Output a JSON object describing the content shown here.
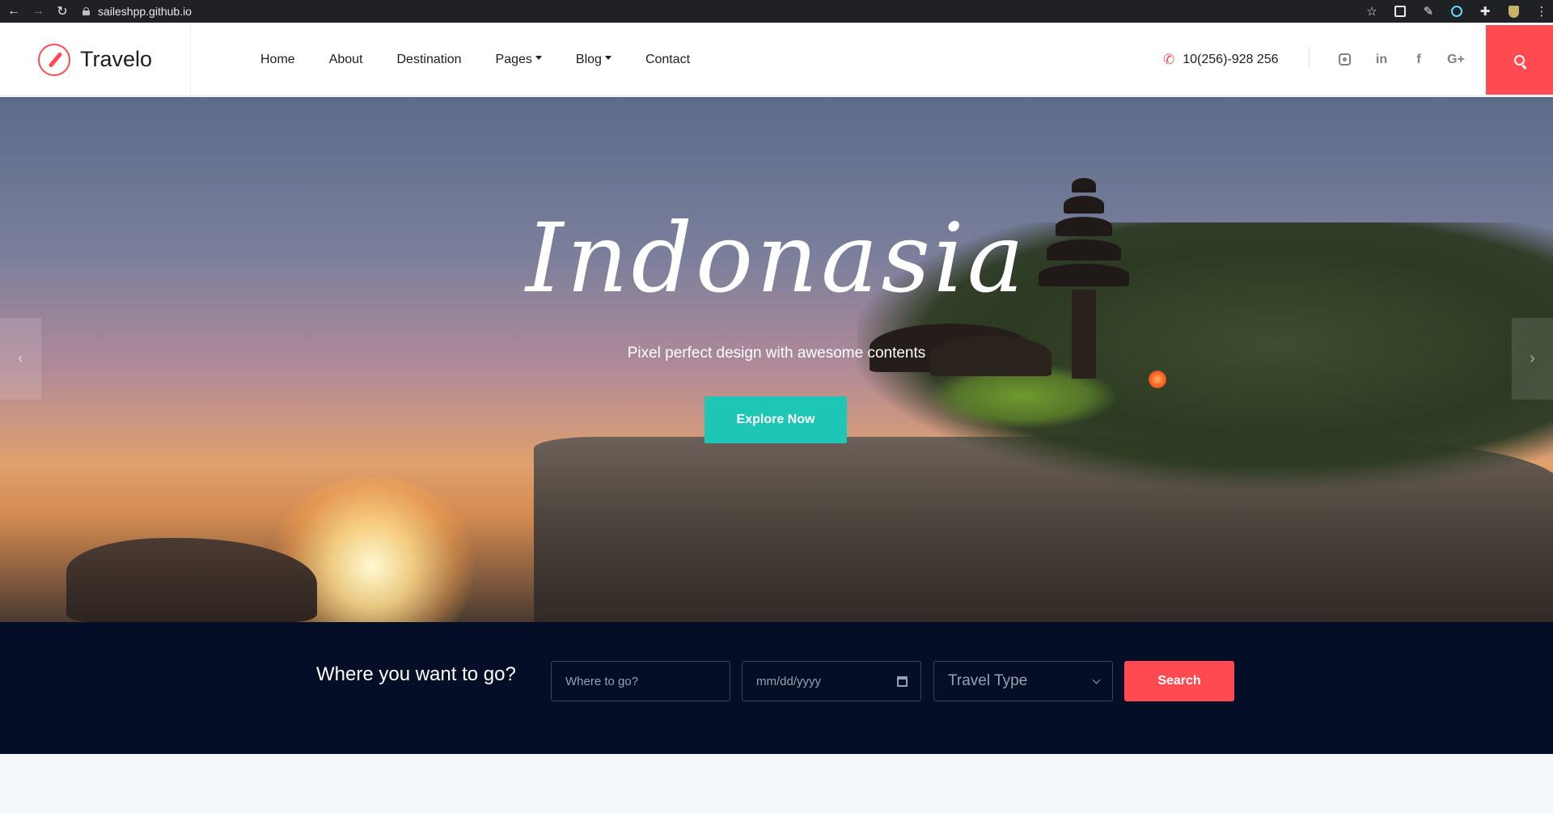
{
  "browser": {
    "url": "saileshpp.github.io"
  },
  "header": {
    "logo_text": "Travelo",
    "nav": [
      {
        "label": "Home"
      },
      {
        "label": "About"
      },
      {
        "label": "Destination"
      },
      {
        "label": "Pages"
      },
      {
        "label": "Blog"
      },
      {
        "label": "Contact"
      }
    ],
    "phone": "10(256)-928 256",
    "social": [
      "instagram-icon",
      "linkedin-icon",
      "facebook-icon",
      "google-plus-icon"
    ],
    "social_glyphs": {
      "linkedin": "in",
      "facebook": "f",
      "google_plus": "G+"
    }
  },
  "hero": {
    "title": "Indonasia",
    "subtitle": "Pixel perfect design with awesome contents",
    "cta": "Explore Now",
    "prev_glyph": "‹",
    "next_glyph": "›"
  },
  "search": {
    "heading": "Where you want to go?",
    "where_placeholder": "Where to go?",
    "date_placeholder": "mm/dd/yyyy",
    "type_selected": "Travel Type",
    "button": "Search"
  },
  "colors": {
    "accent": "#ff4a52",
    "cta": "#1ec6b6",
    "strip_bg": "#040e27"
  }
}
